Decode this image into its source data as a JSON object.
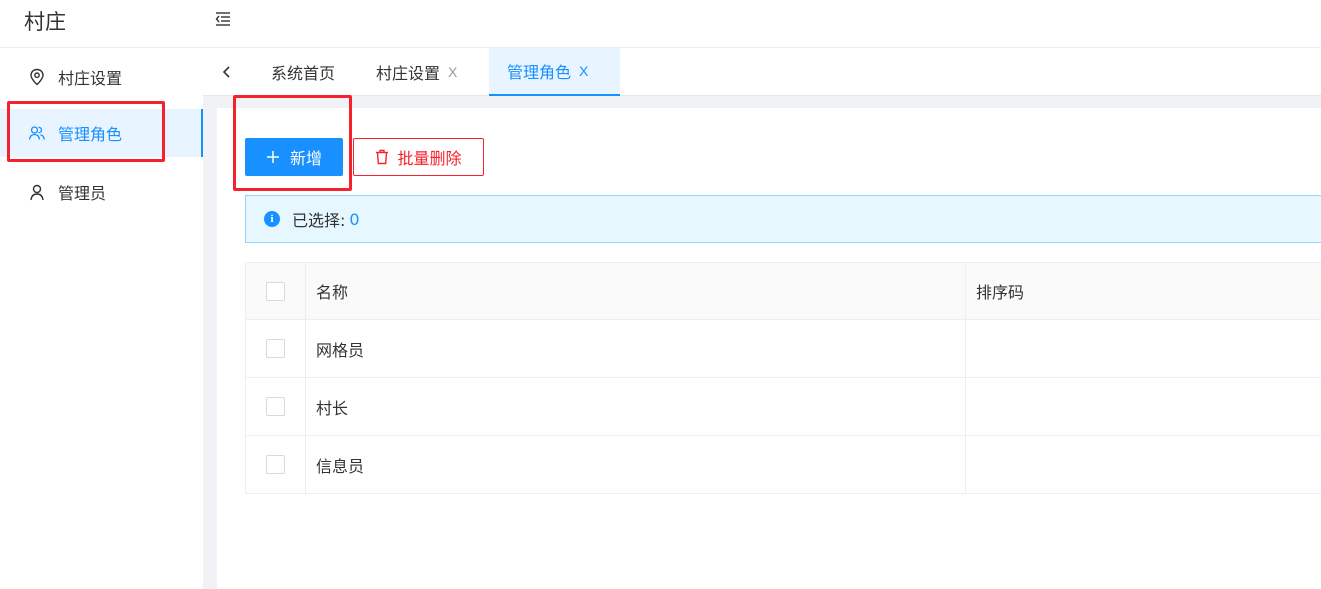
{
  "header": {
    "brand": "村庄",
    "collapse_icon": "menu-fold-icon"
  },
  "sidebar": {
    "items": [
      {
        "label": "村庄设置",
        "icon": "location-pin-icon",
        "active": false
      },
      {
        "label": "管理角色",
        "icon": "users-icon",
        "active": true
      },
      {
        "label": "管理员",
        "icon": "user-icon",
        "active": false
      }
    ]
  },
  "tabs": {
    "back_icon": "chevron-left-icon",
    "close_glyph": "X",
    "items": [
      {
        "label": "系统首页",
        "closable": false,
        "active": false
      },
      {
        "label": "村庄设置",
        "closable": true,
        "active": false
      },
      {
        "label": "管理角色",
        "closable": true,
        "active": true
      }
    ]
  },
  "toolbar": {
    "add_label": "新增",
    "delete_label": "批量删除"
  },
  "selection": {
    "label": "已选择:",
    "count": "0"
  },
  "table": {
    "columns": [
      "名称",
      "排序码"
    ],
    "rows": [
      {
        "name": "网格员",
        "sort": ""
      },
      {
        "name": "村长",
        "sort": ""
      },
      {
        "name": "信息员",
        "sort": ""
      }
    ]
  },
  "colors": {
    "primary": "#1890ff",
    "danger": "#f5222d",
    "active_bg": "#e8f4ff",
    "alert_bg": "#e6f7ff"
  }
}
